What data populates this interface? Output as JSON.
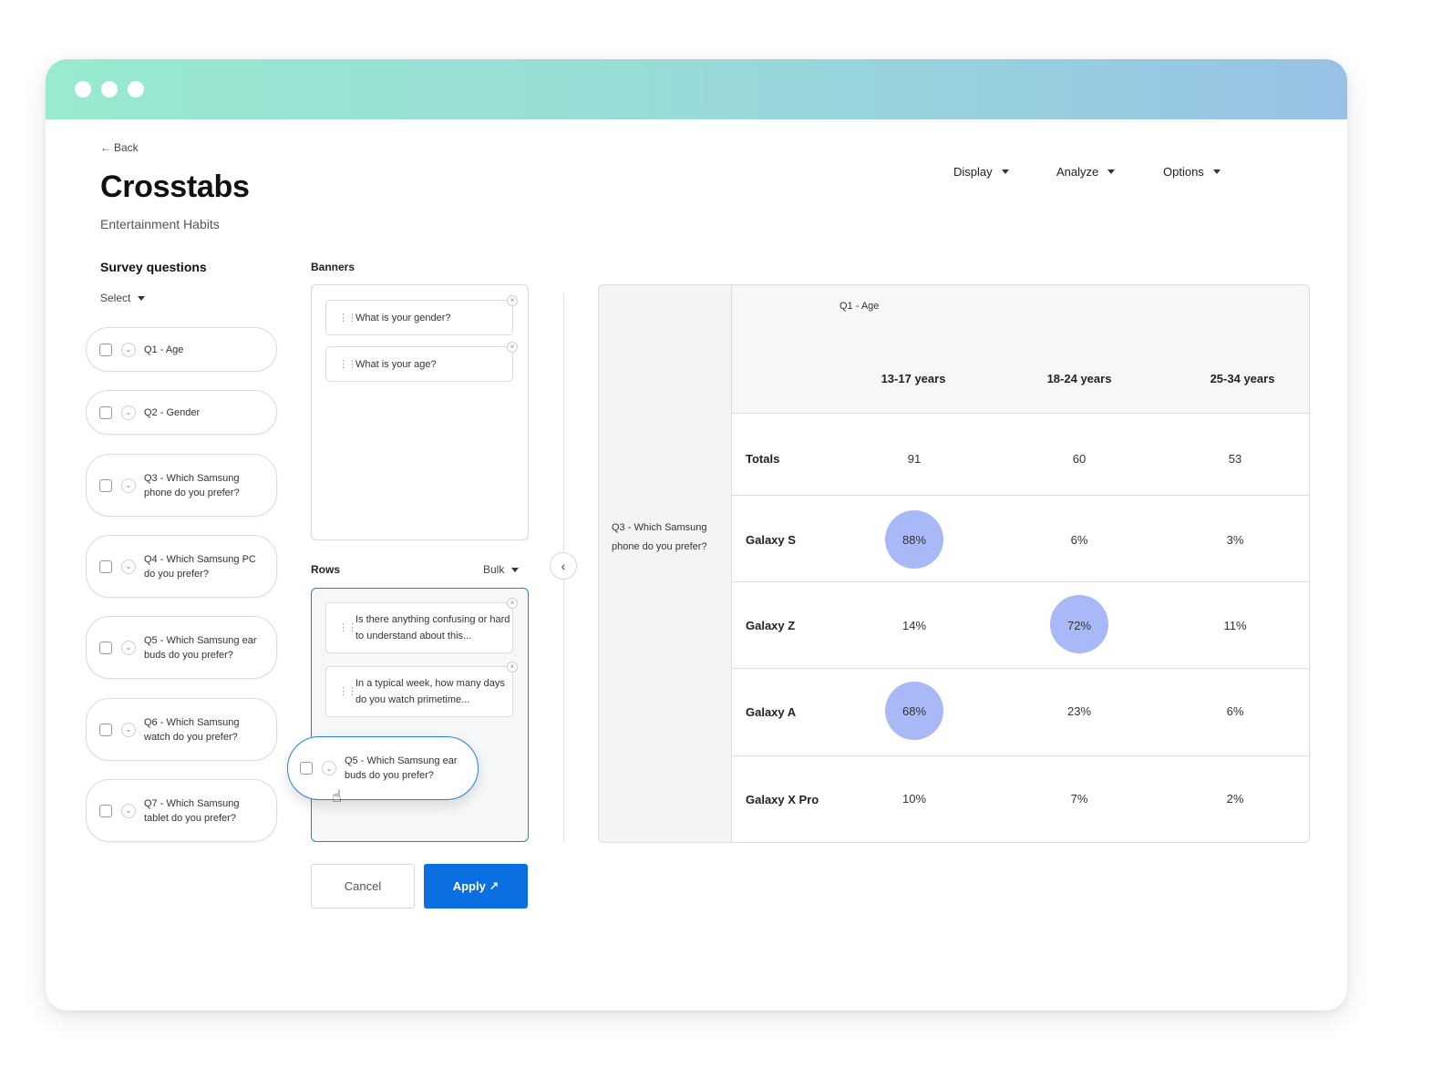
{
  "header": {
    "back_label": "Back",
    "title": "Crosstabs",
    "subtitle": "Entertainment Habits"
  },
  "top_menu": [
    {
      "label": "Display"
    },
    {
      "label": "Analyze"
    },
    {
      "label": "Options"
    }
  ],
  "survey_questions": {
    "title": "Survey questions",
    "select_label": "Select",
    "items": [
      {
        "label": "Q1 - Age"
      },
      {
        "label": "Q2 - Gender"
      },
      {
        "label": "Q3 - Which Samsung phone do you prefer?"
      },
      {
        "label": "Q4 - Which Samsung PC do you prefer?"
      },
      {
        "label": "Q5 - Which Samsung ear buds do you prefer?"
      },
      {
        "label": "Q6 - Which Samsung watch do you prefer?"
      },
      {
        "label": "Q7 - Which Samsung tablet do you prefer?"
      }
    ]
  },
  "banners": {
    "label": "Banners",
    "items": [
      {
        "label": "What is your gender?"
      },
      {
        "label": "What is your age?"
      }
    ]
  },
  "rows": {
    "label": "Rows",
    "bulk_label": "Bulk",
    "items": [
      {
        "label": "Is there anything confusing or hard to understand about this..."
      },
      {
        "label": "In a typical week, how many days do you watch primetime..."
      }
    ],
    "dragging": {
      "label": "Q5 - Which Samsung ear buds do you prefer?"
    }
  },
  "buttons": {
    "cancel": "Cancel",
    "apply": "Apply ↗"
  },
  "crosstab": {
    "row_question": "Q3 - Which Samsung phone do you prefer?",
    "banner_question": "Q1 - Age",
    "columns": [
      "13-17 years",
      "18-24 years",
      "25-34 years"
    ],
    "rows": [
      {
        "label": "Totals",
        "values": [
          "91",
          "60",
          "53"
        ],
        "highlight": [
          false,
          false,
          false
        ]
      },
      {
        "label": "Galaxy S",
        "values": [
          "88%",
          "6%",
          "3%"
        ],
        "highlight": [
          true,
          false,
          false
        ]
      },
      {
        "label": "Galaxy Z",
        "values": [
          "14%",
          "72%",
          "11%"
        ],
        "highlight": [
          false,
          true,
          false
        ]
      },
      {
        "label": "Galaxy A",
        "values": [
          "68%",
          "23%",
          "6%"
        ],
        "highlight": [
          true,
          false,
          false
        ]
      },
      {
        "label": "Galaxy X Pro",
        "values": [
          "10%",
          "7%",
          "2%"
        ],
        "highlight": [
          false,
          false,
          false
        ]
      }
    ],
    "highlight_color": "#a9b9f7"
  },
  "colors": {
    "accent": "#0a6fe0",
    "titlebar_start": "#98ead0",
    "titlebar_end": "#97c2e6"
  }
}
